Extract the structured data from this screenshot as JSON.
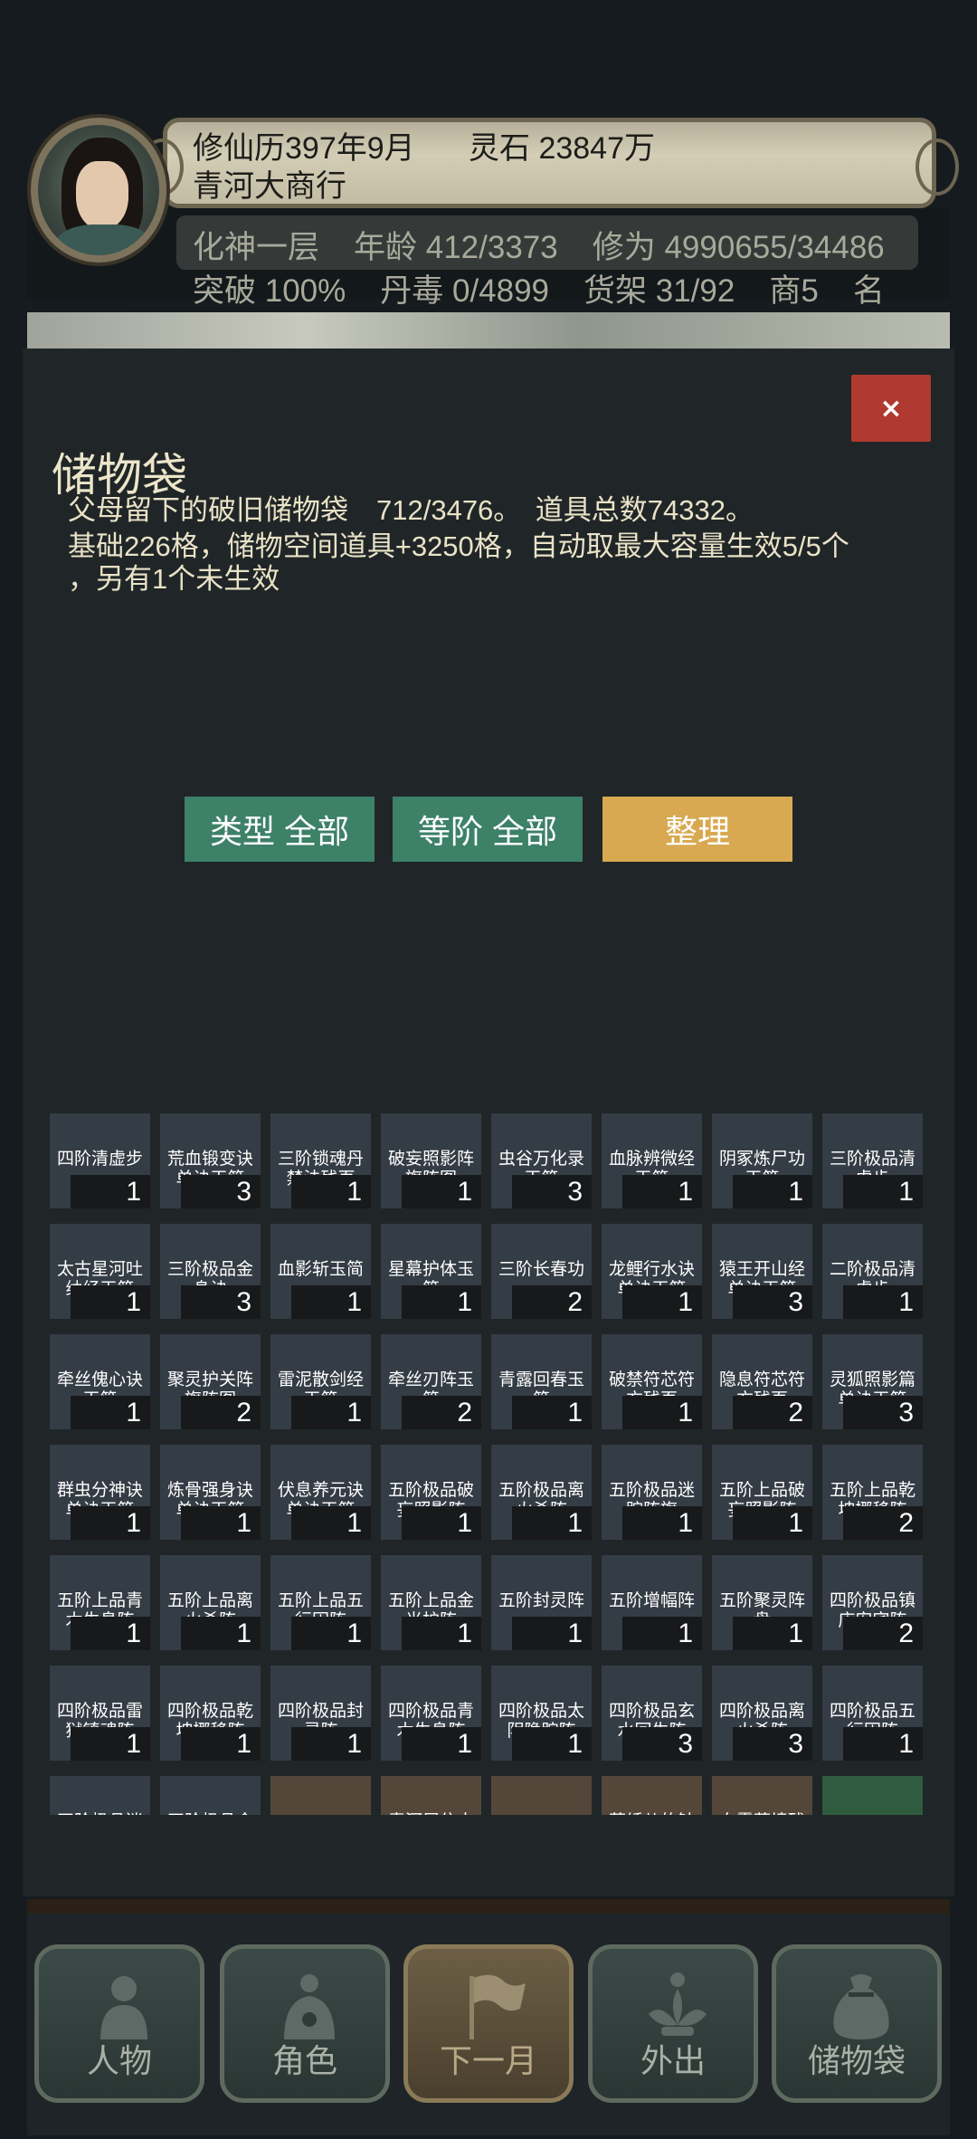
{
  "header": {
    "date": "修仙历397年9月",
    "spirit_stone": "灵石 23847万",
    "shop_name": "青河大商行",
    "realm": "化神一层",
    "age": "年龄 412/3373",
    "cultivation": "修为 4990655/34486",
    "breakthrough": "突破 100%",
    "poison": "丹毒 0/4899",
    "shelf": "货架 31/92",
    "merchant": "商5",
    "extra": "名"
  },
  "panel": {
    "title": "储物袋",
    "close_label": "×",
    "desc_line1": "父母留下的破旧储物袋　712/3476。　道具总数74332。",
    "desc_line2": "基础226格，储物空间道具+3250格，自动取最大容量生效5/5个",
    "desc_line3": "，另有1个未生效"
  },
  "filters": {
    "type_label": "类型 全部",
    "grade_label": "等阶 全部",
    "sort_label": "整理"
  },
  "items": [
    {
      "name": "四阶清虚步",
      "count": "1"
    },
    {
      "name": "荒血锻变诀单诀玉简",
      "count": "3"
    },
    {
      "name": "三阶锁魂丹禁法残页",
      "count": "1"
    },
    {
      "name": "破妄照影阵旗阵图",
      "count": "1"
    },
    {
      "name": "虫谷万化录玉简",
      "count": "3"
    },
    {
      "name": "血脉辨微经玉简",
      "count": "1"
    },
    {
      "name": "阴冢炼尸功玉简",
      "count": "1"
    },
    {
      "name": "三阶极品清虚步",
      "count": "1"
    },
    {
      "name": "太古星河吐纳经玉简",
      "count": "1"
    },
    {
      "name": "三阶极品金身诀",
      "count": "3"
    },
    {
      "name": "血影斩玉简",
      "count": "1"
    },
    {
      "name": "星幕护体玉简",
      "count": "1"
    },
    {
      "name": "三阶长春功",
      "count": "2"
    },
    {
      "name": "龙鲤行水诀单诀玉简",
      "count": "1"
    },
    {
      "name": "猿王开山经单诀玉简",
      "count": "3"
    },
    {
      "name": "二阶极品清虚步",
      "count": "1"
    },
    {
      "name": "牵丝傀心诀玉简",
      "count": "1"
    },
    {
      "name": "聚灵护关阵旗阵图",
      "count": "2"
    },
    {
      "name": "雷泥散剑经玉简",
      "count": "1"
    },
    {
      "name": "牵丝刃阵玉简",
      "count": "2"
    },
    {
      "name": "青露回春玉简",
      "count": "1"
    },
    {
      "name": "破禁符芯符方残页",
      "count": "1"
    },
    {
      "name": "隐息符芯符方残页",
      "count": "2"
    },
    {
      "name": "灵狐照影篇单诀玉简",
      "count": "3"
    },
    {
      "name": "群虫分神诀单诀玉简",
      "count": "1"
    },
    {
      "name": "炼骨强身诀单诀玉简",
      "count": "1"
    },
    {
      "name": "伏息养元诀单诀玉简",
      "count": "1"
    },
    {
      "name": "五阶极品破妄照影阵",
      "count": "1"
    },
    {
      "name": "五阶极品离火杀阵",
      "count": "1"
    },
    {
      "name": "五阶极品迷踪阵旗",
      "count": "1"
    },
    {
      "name": "五阶上品破妄照影阵",
      "count": "1"
    },
    {
      "name": "五阶上品乾坤挪移阵",
      "count": "2"
    },
    {
      "name": "五阶上品青木生息阵",
      "count": "1"
    },
    {
      "name": "五阶上品离火杀阵",
      "count": "1"
    },
    {
      "name": "五阶上品五行困阵",
      "count": "1"
    },
    {
      "name": "五阶上品金光护阵",
      "count": "1"
    },
    {
      "name": "五阶封灵阵",
      "count": "1"
    },
    {
      "name": "五阶增幅阵",
      "count": "1"
    },
    {
      "name": "五阶聚灵阵盘",
      "count": "1"
    },
    {
      "name": "四阶极品镇店安宅阵",
      "count": "2"
    },
    {
      "name": "四阶极品雷狱镇魂阵",
      "count": "1"
    },
    {
      "name": "四阶极品乾坤挪移阵",
      "count": "1"
    },
    {
      "name": "四阶极品封灵阵",
      "count": "1"
    },
    {
      "name": "四阶极品青木生息阵",
      "count": "1"
    },
    {
      "name": "四阶极品太阴隐踪阵",
      "count": "1"
    },
    {
      "name": "四阶极品玄水回生阵",
      "count": "3"
    },
    {
      "name": "四阶极品离火杀阵",
      "count": "3"
    },
    {
      "name": "四阶极品五行困阵",
      "count": "1"
    },
    {
      "name": "四阶极品迷",
      "count": "",
      "style": "normal"
    },
    {
      "name": "四阶极品金",
      "count": "",
      "style": "normal"
    },
    {
      "name": "",
      "count": "",
      "style": "brown"
    },
    {
      "name": "青河居住木",
      "count": "",
      "style": "brown"
    },
    {
      "name": "",
      "count": "",
      "style": "brown"
    },
    {
      "name": "草绣儿的针",
      "count": "",
      "style": "brown"
    },
    {
      "name": "血雾荫境残",
      "count": "",
      "style": "brown"
    },
    {
      "name": "",
      "count": "",
      "style": "green"
    }
  ],
  "nav": [
    {
      "label": "人物",
      "icon": "person-icon"
    },
    {
      "label": "角色",
      "icon": "character-icon"
    },
    {
      "label": "下一月",
      "icon": "flag-icon"
    },
    {
      "label": "外出",
      "icon": "lotus-icon"
    },
    {
      "label": "储物袋",
      "icon": "bag-icon"
    }
  ]
}
